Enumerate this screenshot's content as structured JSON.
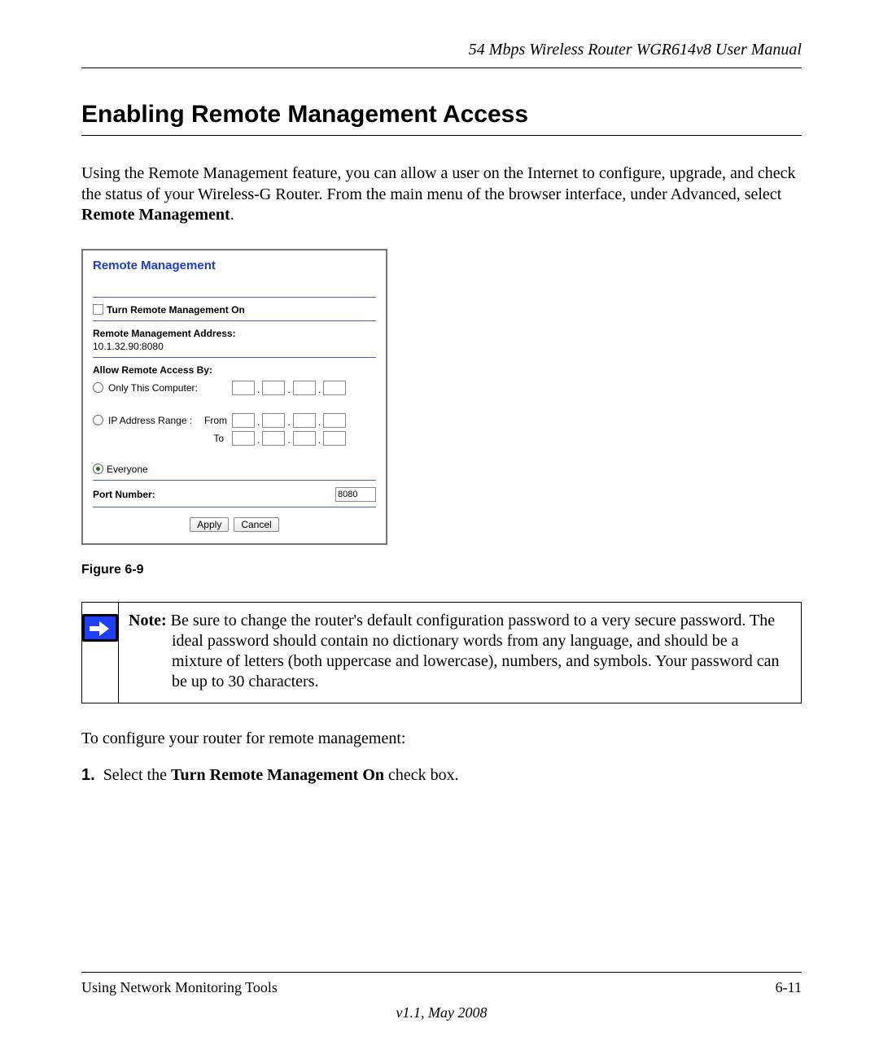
{
  "header": {
    "running": "54 Mbps Wireless Router WGR614v8 User Manual"
  },
  "heading": "Enabling Remote Management Access",
  "intro": {
    "p1a": "Using the Remote Management feature, you can allow a user on the Internet to configure, upgrade, and check the status of your Wireless-G Router. From the main menu of the browser interface, under Advanced, select ",
    "p1b": "Remote Management",
    "p1c": "."
  },
  "screenshot": {
    "title": "Remote Management",
    "turnOnLabel": "Turn Remote Management On",
    "addrLabel": "Remote Management Address:",
    "addrValue": "10.1.32.90:8080",
    "allowLabel": "Allow Remote Access By:",
    "onlyThis": "Only This Computer:",
    "ipRange": "IP Address Range :",
    "from": "From",
    "to": "To",
    "everyone": "Everyone",
    "portLabel": "Port Number:",
    "portValue": "8080",
    "apply": "Apply",
    "cancel": "Cancel"
  },
  "figureCaption": "Figure 6-9",
  "note": {
    "prefix": "Note: ",
    "body": "Be sure to change the router's default configuration password to a very secure password. The ideal password should contain no dictionary words from any language, and should be a mixture of letters (both uppercase and lowercase), numbers, and symbols. Your password can be up to 30 characters."
  },
  "configure": "To configure your router for remote management:",
  "step1": {
    "num": "1.",
    "a": "Select the ",
    "b": "Turn Remote Management On",
    "c": " check box."
  },
  "footer": {
    "left": "Using Network Monitoring Tools",
    "right": "6-11",
    "version": "v1.1, May 2008"
  }
}
